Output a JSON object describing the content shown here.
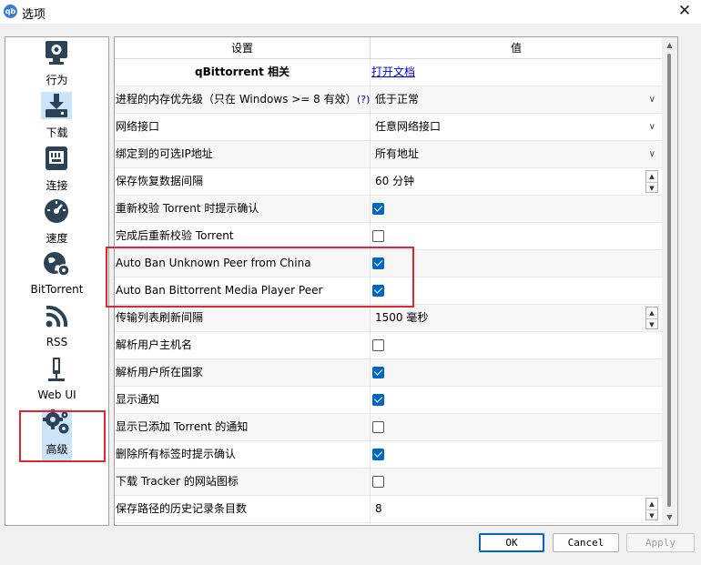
{
  "window": {
    "title": "选项",
    "app_icon": "qb",
    "close": "✕"
  },
  "sidebar": {
    "items": [
      {
        "label": "行为",
        "icon": "gear-monitor-icon"
      },
      {
        "label": "下载",
        "icon": "download-icon"
      },
      {
        "label": "连接",
        "icon": "network-port-icon"
      },
      {
        "label": "速度",
        "icon": "speedometer-icon"
      },
      {
        "label": "BitTorrent",
        "icon": "bittorrent-globe-icon"
      },
      {
        "label": "RSS",
        "icon": "rss-icon"
      },
      {
        "label": "Web UI",
        "icon": "web-ui-icon"
      },
      {
        "label": "高级",
        "icon": "advanced-gears-icon"
      }
    ],
    "selected_index": 7
  },
  "table": {
    "headers": [
      "设置",
      "值"
    ],
    "section": {
      "title": "qBittorrent 相关",
      "link": "打开文档"
    },
    "rows": [
      {
        "key": "进程的内存优先级（只在 Windows >= 8 有效）",
        "help": "(?)",
        "type": "combo",
        "value": "低于正常"
      },
      {
        "key": "网络接口",
        "type": "combo",
        "value": "任意网络接口"
      },
      {
        "key": "绑定到的可选IP地址",
        "type": "combo",
        "value": "所有地址"
      },
      {
        "key": "保存恢复数据间隔",
        "type": "spin",
        "value": "60 分钟"
      },
      {
        "key": "重新校验 Torrent 时提示确认",
        "type": "check",
        "checked": true
      },
      {
        "key": "完成后重新校验 Torrent",
        "type": "check",
        "checked": false
      },
      {
        "key": "Auto Ban Unknown Peer from China",
        "type": "check",
        "checked": true
      },
      {
        "key": "Auto Ban Bittorrent Media Player Peer",
        "type": "check",
        "checked": true
      },
      {
        "key": "传输列表刷新间隔",
        "type": "spin",
        "value": "1500 毫秒"
      },
      {
        "key": "解析用户主机名",
        "type": "check",
        "checked": false
      },
      {
        "key": "解析用户所在国家",
        "type": "check",
        "checked": true
      },
      {
        "key": "显示通知",
        "type": "check",
        "checked": true
      },
      {
        "key": "显示已添加 Torrent 的通知",
        "type": "check",
        "checked": false
      },
      {
        "key": "删除所有标签时提示确认",
        "type": "check",
        "checked": true
      },
      {
        "key": "下载 Tracker 的网站图标",
        "type": "check",
        "checked": false
      },
      {
        "key": "保存路径的历史记录条目数",
        "type": "spin",
        "value": "8"
      }
    ]
  },
  "buttons": {
    "ok": "OK",
    "cancel": "Cancel",
    "apply": "Apply"
  },
  "colors": {
    "accent": "#0067c0",
    "highlight_box": "#e0262e",
    "selected_bg": "#cce4f7",
    "icon_dark": "#2b4257"
  }
}
